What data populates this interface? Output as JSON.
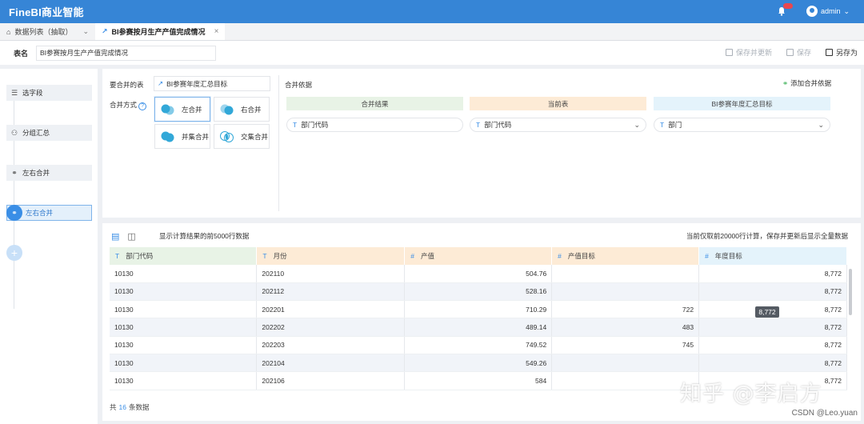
{
  "app": {
    "brand": "FineBI商业智能",
    "user": "admin"
  },
  "tabs": [
    {
      "label": "数据列表（抽取）"
    },
    {
      "label": "BI参赛按月生产产值完成情况"
    }
  ],
  "header": {
    "label": "表名",
    "value": "BI参赛按月生产产值完成情况",
    "save_update": "保存并更新",
    "save": "保存",
    "save_as": "另存为"
  },
  "steps": [
    {
      "label": "选字段"
    },
    {
      "label": "分组汇总"
    },
    {
      "label": "左右合并"
    },
    {
      "label": "左右合并"
    }
  ],
  "merge": {
    "table_label": "要合并的表",
    "table_value": "BI参赛年度汇总目标",
    "mode_label": "合并方式",
    "modes": [
      "左合并",
      "右合并",
      "并集合并",
      "交集合并"
    ],
    "basis_label": "合并依据",
    "add_basis": "添加合并依据",
    "columns": [
      {
        "title": "合并结果",
        "field": "部门代码",
        "color": "#e8f3e6"
      },
      {
        "title": "当前表",
        "field": "部门代码",
        "color": "#fdebd6"
      },
      {
        "title": "BI参赛年度汇总目标",
        "field": "部门",
        "color": "#e4f3fb"
      }
    ]
  },
  "results": {
    "note_left": "显示计算结果的前5000行数据",
    "note_right": "当前仅取前20000行计算，保存并更新后显示全量数据",
    "headers": [
      {
        "type": "T",
        "label": "部门代码",
        "color": "#e8f3e6"
      },
      {
        "type": "T",
        "label": "月份",
        "color": "#fdebd6"
      },
      {
        "type": "#",
        "label": "产值",
        "color": "#fdebd6"
      },
      {
        "type": "#",
        "label": "产值目标",
        "color": "#fdebd6"
      },
      {
        "type": "#",
        "label": "年度目标",
        "color": "#e4f3fb"
      }
    ],
    "rows": [
      [
        "10130",
        "202110",
        "504.76",
        "",
        "8,772"
      ],
      [
        "10130",
        "202112",
        "528.16",
        "",
        "8,772"
      ],
      [
        "10130",
        "202201",
        "710.29",
        "722",
        "8,772"
      ],
      [
        "10130",
        "202202",
        "489.14",
        "483",
        "8,772"
      ],
      [
        "10130",
        "202203",
        "749.52",
        "745",
        "8,772"
      ],
      [
        "10130",
        "202104",
        "549.26",
        "",
        "8,772"
      ],
      [
        "10130",
        "202106",
        "584",
        "",
        "8,772"
      ]
    ],
    "tooltip": "8,772",
    "footer_prefix": "共",
    "footer_count": "16",
    "footer_suffix": "条数据"
  },
  "watermark": {
    "main": "知乎 @李启方",
    "csdn": "CSDN @Leo.yuan"
  }
}
